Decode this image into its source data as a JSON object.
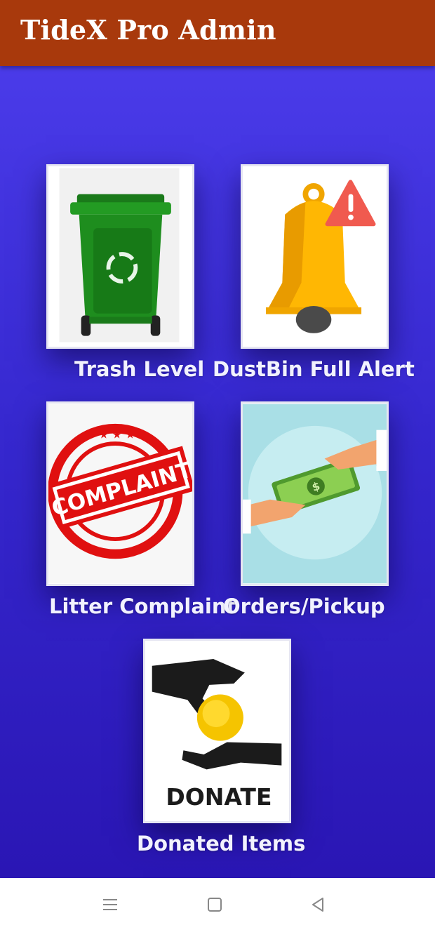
{
  "appbar": {
    "title": "TideX Pro Admin",
    "color": "#a8390c"
  },
  "tiles": [
    {
      "label": "Trash Level",
      "icon": "trash-bin-icon"
    },
    {
      "label": "DustBin Full Alert",
      "icon": "bell-alert-icon"
    },
    {
      "label": "Litter Complaint",
      "icon": "complaint-stamp-icon"
    },
    {
      "label": "Orders/Pickup",
      "icon": "money-handover-icon"
    },
    {
      "label": "Donated Items",
      "icon": "donate-hands-icon",
      "image_text": "DONATE"
    }
  ],
  "stamp_text": "COMPLAINT",
  "navbar": {
    "buttons": [
      "menu",
      "home",
      "back"
    ]
  }
}
